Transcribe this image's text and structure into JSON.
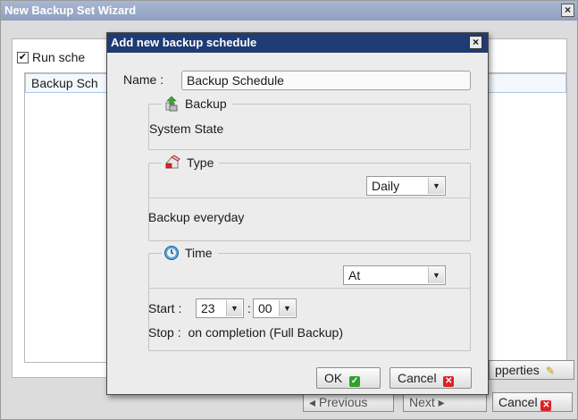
{
  "wizard": {
    "title": "New Backup Set Wizard",
    "close_glyph": "×",
    "run_schedule_label": "Run sche",
    "run_schedule_checked": true,
    "schedule_item": "Backup Sch",
    "properties_label": "pperties",
    "previous_label": "◂  Previous",
    "next_label": "Next  ▸",
    "cancel_label": "Cancel"
  },
  "dialog": {
    "title": "Add new backup schedule",
    "close_glyph": "×",
    "name_label": "Name :",
    "name_value": "Backup Schedule",
    "backup": {
      "legend": "Backup",
      "value": "System State",
      "icon": "backup-icon"
    },
    "type": {
      "legend": "Type",
      "selected": "Daily",
      "description": "Backup everyday",
      "icon": "type-icon"
    },
    "time": {
      "legend": "Time",
      "mode_selected": "At",
      "start_label": "Start :",
      "start_hour": "23",
      "time_separator": ":",
      "start_minute": "00",
      "stop_label": "Stop :",
      "stop_value": "on completion (Full Backup)",
      "icon": "clock-icon"
    },
    "ok_label": "OK",
    "cancel_label": "Cancel"
  },
  "colors": {
    "dialog_title_bg": "#1f3b73",
    "wizard_title_bg": "#a9b7d1",
    "ok_icon": "#33a02c",
    "cancel_icon": "#d9232a"
  }
}
